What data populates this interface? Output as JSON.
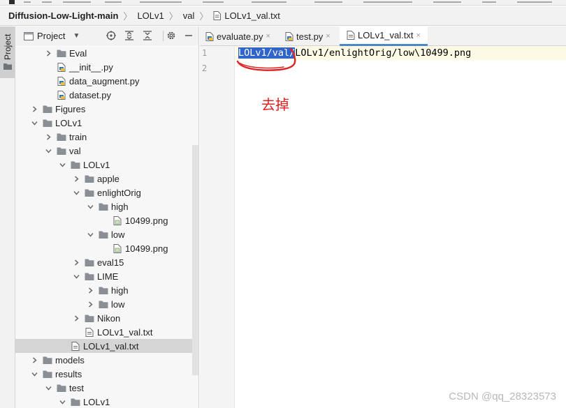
{
  "colors": {
    "folder": "#8a8f96",
    "selection_bg": "#2f65ca",
    "annotation_red": "#e02222",
    "active_tab_underline": "#4a88c7"
  },
  "breadcrumb": {
    "items": [
      "Diffusion-Low-Light-main",
      "LOLv1",
      "val",
      "LOLv1_val.txt"
    ]
  },
  "tool_strip": {
    "project_tab": "Project"
  },
  "project_panel": {
    "title": "Project",
    "tree": [
      {
        "label": "Eval",
        "type": "folder",
        "depth": 2,
        "arrow": "right"
      },
      {
        "label": "__init__.py",
        "type": "python",
        "depth": 2,
        "arrow": "none"
      },
      {
        "label": "data_augment.py",
        "type": "python",
        "depth": 2,
        "arrow": "none"
      },
      {
        "label": "dataset.py",
        "type": "python",
        "depth": 2,
        "arrow": "none"
      },
      {
        "label": "Figures",
        "type": "folder",
        "depth": 1,
        "arrow": "right"
      },
      {
        "label": "LOLv1",
        "type": "folder",
        "depth": 1,
        "arrow": "down"
      },
      {
        "label": "train",
        "type": "folder",
        "depth": 2,
        "arrow": "right"
      },
      {
        "label": "val",
        "type": "folder",
        "depth": 2,
        "arrow": "down"
      },
      {
        "label": "LOLv1",
        "type": "folder",
        "depth": 3,
        "arrow": "down"
      },
      {
        "label": "apple",
        "type": "folder",
        "depth": 4,
        "arrow": "right"
      },
      {
        "label": "enlightOrig",
        "type": "folder",
        "depth": 4,
        "arrow": "down"
      },
      {
        "label": "high",
        "type": "folder",
        "depth": 5,
        "arrow": "down"
      },
      {
        "label": "10499.png",
        "type": "image",
        "depth": 6,
        "arrow": "none"
      },
      {
        "label": "low",
        "type": "folder",
        "depth": 5,
        "arrow": "down"
      },
      {
        "label": "10499.png",
        "type": "image",
        "depth": 6,
        "arrow": "none"
      },
      {
        "label": "eval15",
        "type": "folder",
        "depth": 4,
        "arrow": "right"
      },
      {
        "label": "LIME",
        "type": "folder",
        "depth": 4,
        "arrow": "down"
      },
      {
        "label": "high",
        "type": "folder",
        "depth": 5,
        "arrow": "right"
      },
      {
        "label": "low",
        "type": "folder",
        "depth": 5,
        "arrow": "right"
      },
      {
        "label": "Nikon",
        "type": "folder",
        "depth": 4,
        "arrow": "right"
      },
      {
        "label": "LOLv1_val.txt",
        "type": "text",
        "depth": 4,
        "arrow": "none"
      },
      {
        "label": "LOLv1_val.txt",
        "type": "text",
        "depth": 3,
        "arrow": "none",
        "selected": true
      },
      {
        "label": "models",
        "type": "folder",
        "depth": 1,
        "arrow": "right"
      },
      {
        "label": "results",
        "type": "folder",
        "depth": 1,
        "arrow": "down"
      },
      {
        "label": "test",
        "type": "folder",
        "depth": 2,
        "arrow": "down"
      },
      {
        "label": "LOLv1",
        "type": "folder",
        "depth": 3,
        "arrow": "down"
      }
    ]
  },
  "editor": {
    "tabs": [
      {
        "label": "evaluate.py",
        "type": "python",
        "active": false
      },
      {
        "label": "test.py",
        "type": "python",
        "active": false
      },
      {
        "label": "LOLv1_val.txt",
        "type": "text",
        "active": true
      }
    ],
    "line_numbers": [
      "1",
      "2"
    ],
    "line1": {
      "selected": "LOLv1/val/",
      "rest": "LOLv1/enlightOrig/low\\10499.png"
    }
  },
  "annotation": {
    "text": "去掉"
  },
  "watermark": {
    "text": "CSDN @qq_28323573"
  }
}
